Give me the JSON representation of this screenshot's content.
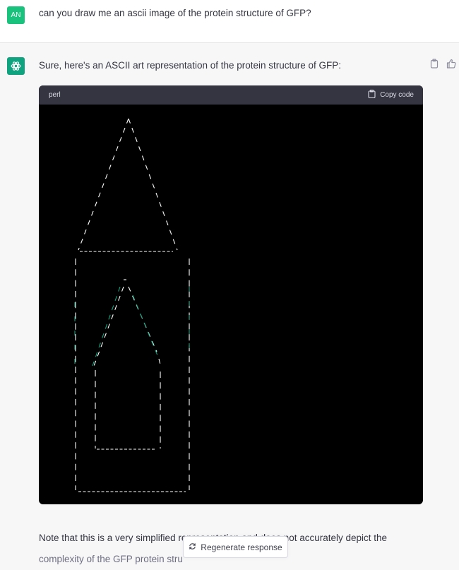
{
  "user_message": {
    "avatar_initials": "AN",
    "text": "can you draw me an ascii image of the protein structure of GFP?"
  },
  "assistant_message": {
    "intro": "Sure, here's an ASCII art representation of the protein structure of GFP:",
    "code_block": {
      "language": "perl",
      "copy_label": "Copy code"
    },
    "note_line1": "Note that this is a very simplified representation and does not accurately depict the",
    "note_line2": "complexity of the GFP protein stru"
  },
  "regenerate_label": "Regenerate response",
  "colors": {
    "user_avatar": "#19c37d",
    "bot_logo": "#10a37f",
    "code_header": "#343541",
    "code_bg": "#000000",
    "ascii_text": "#ffffff",
    "ascii_accent": "#10a37f"
  }
}
